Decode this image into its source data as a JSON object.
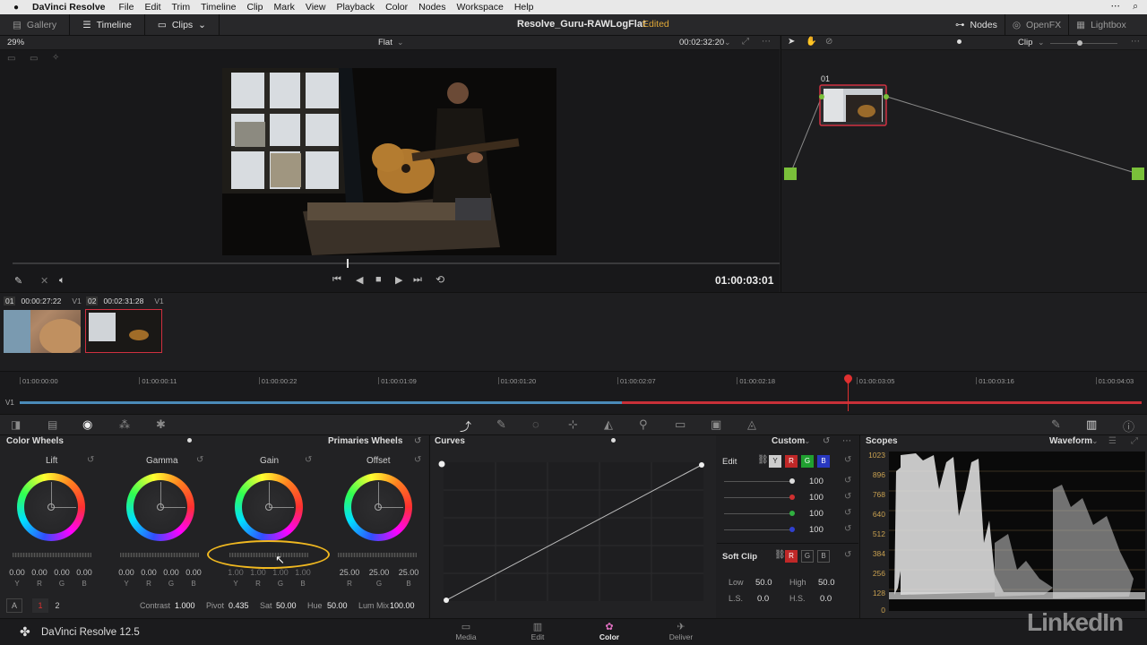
{
  "menubar": {
    "app": "DaVinci Resolve",
    "items": [
      "File",
      "Edit",
      "Trim",
      "Timeline",
      "Clip",
      "Mark",
      "View",
      "Playback",
      "Color",
      "Nodes",
      "Workspace",
      "Help"
    ]
  },
  "toolbar": {
    "gallery": "Gallery",
    "timeline": "Timeline",
    "clips": "Clips",
    "project_title": "Resolve_Guru-RAWLogFlat",
    "status": "Edited",
    "nodes": "Nodes",
    "openfx": "OpenFX",
    "lightbox": "Lightbox"
  },
  "viewer": {
    "zoom": "29%",
    "lut": "Flat",
    "timecode_top": "00:02:32:20",
    "timecode": "01:00:03:01"
  },
  "nodepanel": {
    "mode": "Clip",
    "node_label": "01"
  },
  "clips": [
    {
      "num": "01",
      "tc": "00:00:27:22",
      "track": "V1"
    },
    {
      "num": "02",
      "tc": "00:02:31:28",
      "track": "V1"
    }
  ],
  "timeline": {
    "track": "V1",
    "ruler": [
      "01:00:00:00",
      "01:00:00:11",
      "01:00:00:22",
      "01:00:01:09",
      "01:00:01:20",
      "01:00:02:07",
      "01:00:02:18",
      "01:00:03:05",
      "01:00:03:16",
      "01:00:04:03"
    ]
  },
  "wheels": {
    "title": "Color Wheels",
    "mode": "Primaries Wheels",
    "items": [
      {
        "label": "Lift",
        "values": [
          "0.00",
          "0.00",
          "0.00",
          "0.00"
        ]
      },
      {
        "label": "Gamma",
        "values": [
          "0.00",
          "0.00",
          "0.00",
          "0.00"
        ]
      },
      {
        "label": "Gain",
        "values": [
          "1.00",
          "1.00",
          "1.00",
          "1.00"
        ]
      },
      {
        "label": "Offset",
        "values": [
          "25.00",
          "25.00",
          "25.00"
        ]
      }
    ],
    "chans4": [
      "Y",
      "R",
      "G",
      "B"
    ],
    "chans3": [
      "R",
      "G",
      "B"
    ],
    "footer": {
      "a": "A",
      "p1": "1",
      "p2": "2",
      "contrast_label": "Contrast",
      "contrast": "1.000",
      "pivot_label": "Pivot",
      "pivot": "0.435",
      "sat_label": "Sat",
      "sat": "50.00",
      "hue_label": "Hue",
      "hue": "50.00",
      "lummix_label": "Lum Mix",
      "lummix": "100.00"
    }
  },
  "curves": {
    "title": "Curves",
    "mode": "Custom",
    "edit_label": "Edit",
    "channels": [
      "Y",
      "R",
      "G",
      "B"
    ],
    "values": [
      "100",
      "100",
      "100",
      "100"
    ],
    "softclip_label": "Soft Clip",
    "low_label": "Low",
    "low": "50.0",
    "high_label": "High",
    "high": "50.0",
    "ls_label": "L.S.",
    "ls": "0.0",
    "hs_label": "H.S.",
    "hs": "0.0"
  },
  "scopes": {
    "title": "Scopes",
    "mode": "Waveform",
    "axis": [
      "1023",
      "896",
      "768",
      "640",
      "512",
      "384",
      "256",
      "128",
      "0"
    ]
  },
  "bottombar": {
    "app_version": "DaVinci Resolve 12.5",
    "pages": [
      "Media",
      "Edit",
      "Color",
      "Deliver"
    ],
    "watermark": "LinkedIn"
  },
  "colors": {
    "accent": "#e0a838",
    "active_node": "#d03040",
    "playhead": "#e03030",
    "highlight": "#f0b820"
  }
}
